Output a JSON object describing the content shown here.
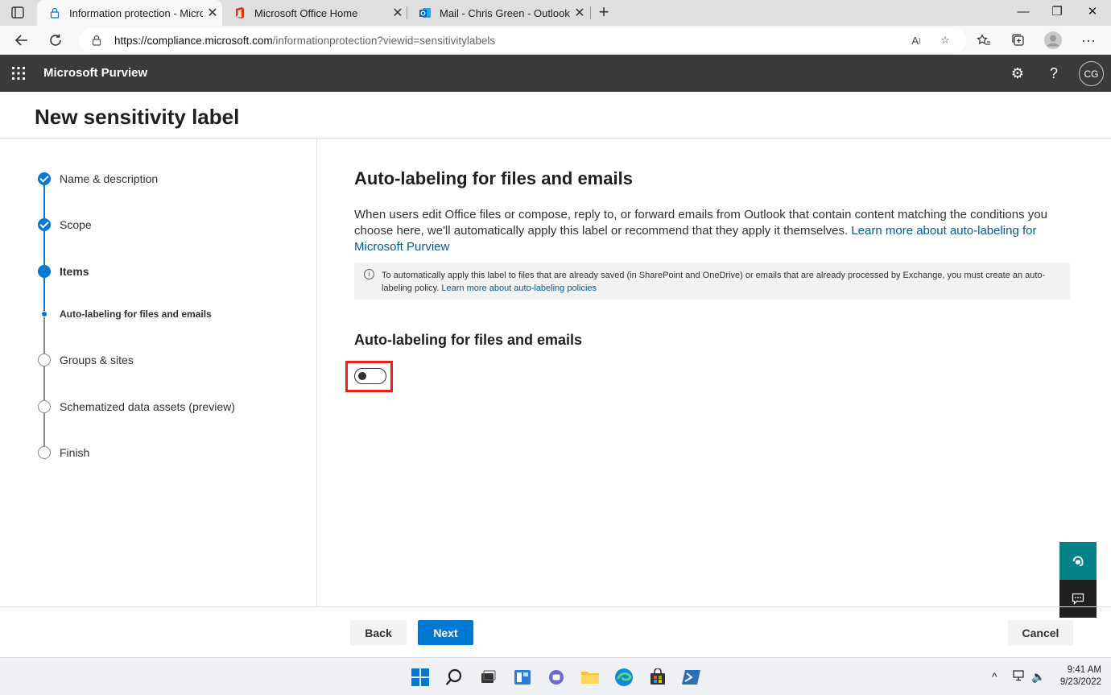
{
  "browser": {
    "tabs": [
      {
        "title": "Information protection - Microsc",
        "icon": "lock-icon",
        "active": true
      },
      {
        "title": "Microsoft Office Home",
        "icon": "office-icon",
        "active": false
      },
      {
        "title": "Mail - Chris Green - Outlook",
        "icon": "outlook-icon",
        "active": false
      }
    ],
    "url_host": "https://compliance.microsoft.com",
    "url_path": "/informationprotection?viewid=sensitivitylabels"
  },
  "app": {
    "name": "Microsoft Purview",
    "user_initials": "CG"
  },
  "page": {
    "title": "New sensitivity label"
  },
  "steps": [
    {
      "label": "Name & description",
      "state": "done"
    },
    {
      "label": "Scope",
      "state": "done"
    },
    {
      "label": "Items",
      "state": "current"
    },
    {
      "label": "Auto-labeling for files and emails",
      "state": "substep-current"
    },
    {
      "label": "Groups & sites",
      "state": "todo"
    },
    {
      "label": "Schematized data assets (preview)",
      "state": "todo"
    },
    {
      "label": "Finish",
      "state": "todo"
    }
  ],
  "main": {
    "heading": "Auto-labeling for files and emails",
    "description": "When users edit Office files or compose, reply to, or forward emails from Outlook that contain content matching the conditions you choose here, we'll automatically apply this label or recommend that they apply it themselves.",
    "description_link": "Learn more about auto-labeling for Microsoft Purview",
    "info_text": "To automatically apply this label to files that are already saved (in SharePoint and OneDrive) or emails that are already processed by Exchange, you must create an auto-labeling policy.",
    "info_link": "Learn more about auto-labeling policies",
    "section_heading": "Auto-labeling for files and emails",
    "toggle_on": false
  },
  "footer": {
    "back_label": "Back",
    "next_label": "Next",
    "cancel_label": "Cancel"
  },
  "taskbar": {
    "time": "9:41 AM",
    "date": "9/23/2022"
  },
  "colors": {
    "accent": "#0078d4",
    "header_bg": "#3b3a39",
    "highlight": "#e8220e",
    "help_fab": "#038387"
  }
}
